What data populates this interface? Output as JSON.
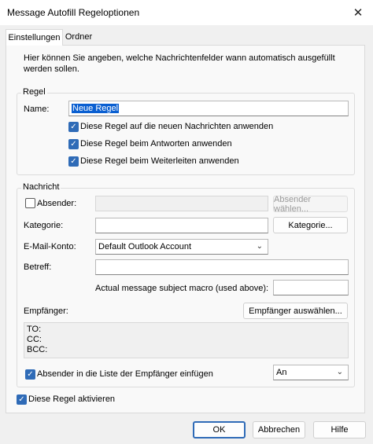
{
  "window": {
    "title": "Message Autofill Regeloptionen",
    "close_glyph": "✕"
  },
  "tabs": [
    {
      "label": "Einstellungen",
      "active": true
    },
    {
      "label": "Ordner",
      "active": false
    }
  ],
  "description": "Hier können Sie angeben, welche Nachrichtenfelder wann automatisch ausgefüllt werden sollen.",
  "regel": {
    "group_label": "Regel",
    "name_label": "Name:",
    "name_value": "Neue Regel",
    "options": [
      {
        "label": "Diese Regel auf die neuen Nachrichten anwenden",
        "checked": true
      },
      {
        "label": "Diese Regel beim Antworten anwenden",
        "checked": true
      },
      {
        "label": "Diese Regel beim Weiterleiten anwenden",
        "checked": true
      }
    ]
  },
  "nachricht": {
    "group_label": "Nachricht",
    "absender_label": "Absender:",
    "absender_checked": false,
    "absender_button": "Absender wählen...",
    "kategorie_label": "Kategorie:",
    "kategorie_button": "Kategorie...",
    "konto_label": "E-Mail-Konto:",
    "konto_value": "Default Outlook Account",
    "betreff_label": "Betreff:",
    "macro_label": "Actual message subject macro (used above):",
    "empfaenger_label": "Empfänger:",
    "empfaenger_button": "Empfänger auswählen...",
    "recipients": {
      "to": "TO:",
      "cc": "CC:",
      "bcc": "BCC:"
    },
    "insert_sender_label": "Absender in die Liste der Empfänger einfügen",
    "insert_sender_checked": true,
    "insert_position_value": "An"
  },
  "activate_label": "Diese Regel aktivieren",
  "activate_checked": true,
  "footer": {
    "ok": "OK",
    "cancel": "Abbrechen",
    "help": "Hilfe"
  },
  "colors": {
    "accent": "#2f6bb7",
    "selection": "#0a5fd1",
    "ok_border": "#2f6bb7"
  }
}
